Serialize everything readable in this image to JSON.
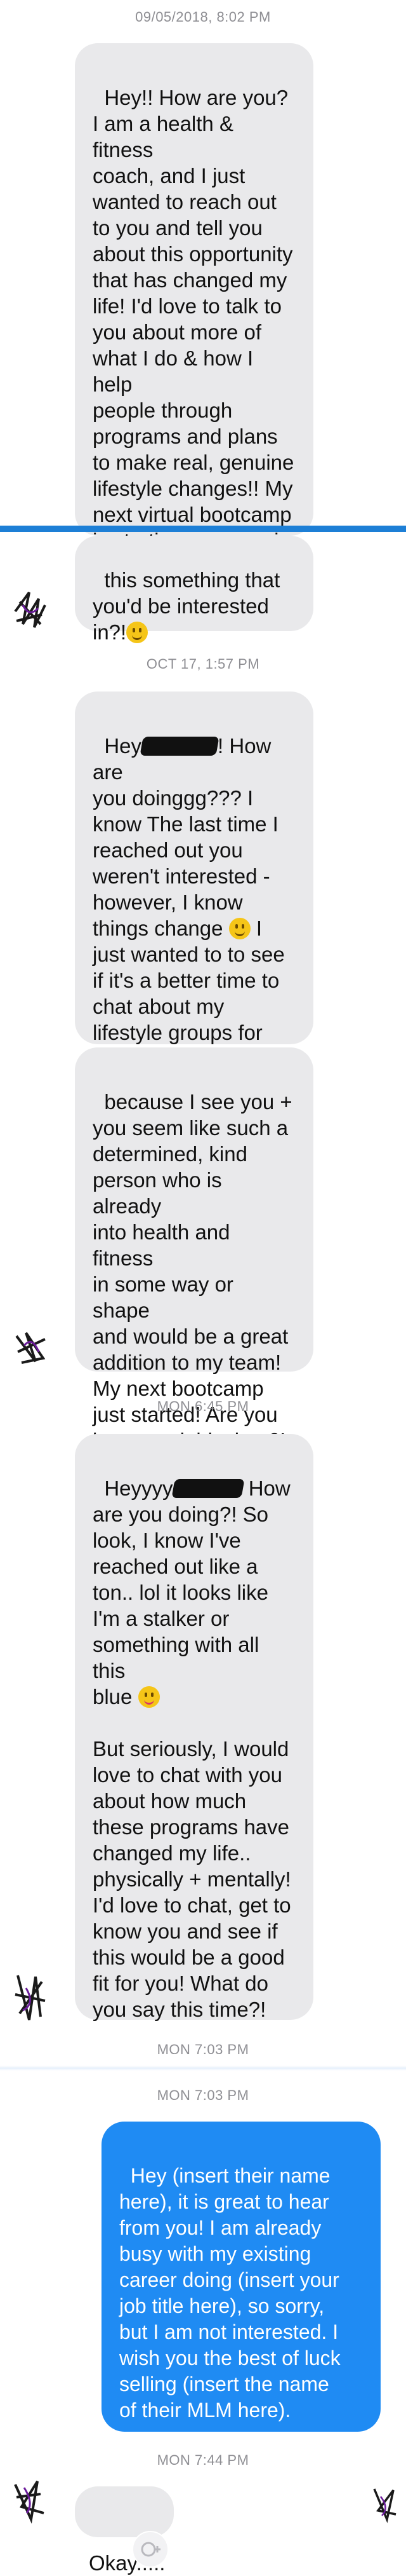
{
  "messages": {
    "ts1": "09/05/2018, 8:02 PM",
    "m1a": "Hey!! How are you?\nI am a health & fitness\ncoach, and I just\nwanted to reach out\nto you and tell you\nabout this opportunity\nthat has changed my\nlife! I'd love to talk to\nyou about more of\nwhat I do & how I help\npeople through\nprograms and plans\nto make real, genuine\nlifestyle changes!! My\nnext virtual bootcamp\nis starting up soon, is",
    "m1b_1": "this something that\nyou'd be interested\nin?!",
    "ts2": "OCT 17, 1:57 PM",
    "m2a_pre": "Hey",
    "m2a_post": "! How are\nyou doinggg??? I\nknow The last time I\nreached out you\nweren't interested -\nhowever, I know\nthings change",
    "m2a_end": " I\njust wanted to to see\nif it's a better time to\nchat about my\nlifestyle groups for\nhealth and fitness",
    "m2b": "because I see you +\nyou seem like such a\ndetermined, kind\nperson who is already\ninto health and fitness\nin some way or shape\nand would be a great\naddition to my team!\nMy next bootcamp\njust started! Are you\ninterested this time?!",
    "ts3": "MON 6:45 PM",
    "m3_pre": "Heyyyy",
    "m3_post": " How\nare you doing?! So\nlook, I know I've\nreached out like a\nton.. lol it looks like\nI'm a stalker or\nsomething with all this\nblue",
    "m3_rest": "But seriously, I would\nlove to chat with you\nabout how much\nthese programs have\nchanged my life..\nphysically + mentally!\nI'd love to chat, get to\nknow you and see if\nthis would be a good\nfit for you! What do\nyou say this time?!",
    "ts4": "MON 7:03 PM",
    "ts5": "MON 7:03 PM",
    "m4": "Hey (insert their name\nhere), it is great to hear\nfrom you! I am already\nbusy with my existing\ncareer doing (insert your\njob title here), so sorry,\nbut I am not interested. I\nwish you the best of luck\nselling (insert the name\nof their MLM here).",
    "ts6": "MON 7:44 PM",
    "m5": "Okay....."
  },
  "colors": {
    "incoming": "#e9e9eb",
    "outgoing": "#1f8bf3",
    "timestamp": "#8e8e93",
    "seam": "#1d7fd6"
  },
  "icons": [
    "avatar-scribble",
    "slightly-smiling-emoji",
    "winking-tongue-emoji",
    "add-reaction-icon"
  ]
}
